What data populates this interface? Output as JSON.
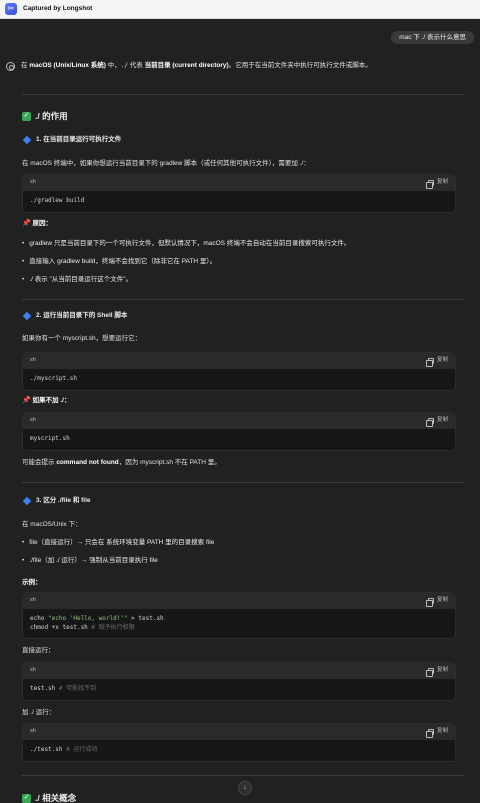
{
  "app": {
    "title": "Captured by Longshot",
    "icon": "longshot-app-icon"
  },
  "user_message": "mac 下 ./ 表示什么意思",
  "intro": {
    "p1": "在 ",
    "b1": "macOS (Unix/Linux 系统)",
    "p2": " 中，",
    "c1": "./",
    "p3": " 代表 ",
    "b2": "当前目录 (current directory)",
    "p4": "。它用于在当前文件夹中执行可执行文件或脚本。"
  },
  "sec1": {
    "title": "./ 的作用",
    "sub1": "1. 在当前目录运行可执行文件",
    "desc": "在 macOS 终端中，如果你想运行当前目录下的 gradlew 脚本（或任何其他可执行文件），需要加 ./：",
    "code1_lang": "sh",
    "code1": "./gradlew build",
    "reason_title": "原因：",
    "reasons": [
      "gradlew 只是当前目录下的一个可执行文件，但默认情况下，macOS 终端不会自动在当前目录搜索可执行文件。",
      "直接输入 gradlew build，终端不会找到它（除非它在 PATH 里）。",
      "./ 表示 \"从当前目录运行这个文件\"。"
    ]
  },
  "sec2": {
    "sub": "2. 运行当前目录下的 Shell 脚本",
    "desc": "如果你有一个 myscript.sh，想要运行它：",
    "code1_lang": "sh",
    "code1": "./myscript.sh",
    "noadd": "如果不加 ./：",
    "code2_lang": "sh",
    "code2": "myscript.sh",
    "result_pre": "可能会提示 ",
    "result_bold": "command not found",
    "result_post": "，因为 myscript.sh 不在 PATH 里。"
  },
  "sec3": {
    "sub": "3. 区分 ./file 和 file",
    "desc": "在 macOS/Unix 下：",
    "bullets": [
      "file（直接运行）→ 只会在 系统环境变量 PATH 里的目录搜索 file",
      "./file（加 ./ 运行）→ 强制从当前目录执行 file"
    ],
    "example": "示例：",
    "code1_lang": "sh",
    "code1_l1a": "echo ",
    "code1_l1b": "\"echo 'Hello, world!'\"",
    "code1_l1c": " > test.sh",
    "code1_l2a": "chmod +x test.sh",
    "code1_l2b": "  # 赋予执行权限",
    "direct": "直接运行：",
    "code2_lang": "sh",
    "code2a": "test.sh",
    "code2b": "  # 可能找不到",
    "add": "加 ./ 运行：",
    "code3_lang": "sh",
    "code3a": "./test.sh",
    "code3b": "  # 运行成功"
  },
  "sec4": {
    "title": "./ 相关概念"
  },
  "copy_label": "复制",
  "colors": {
    "bg": "#212121",
    "check": "#3aa757",
    "diamond": "#3b82f6"
  }
}
